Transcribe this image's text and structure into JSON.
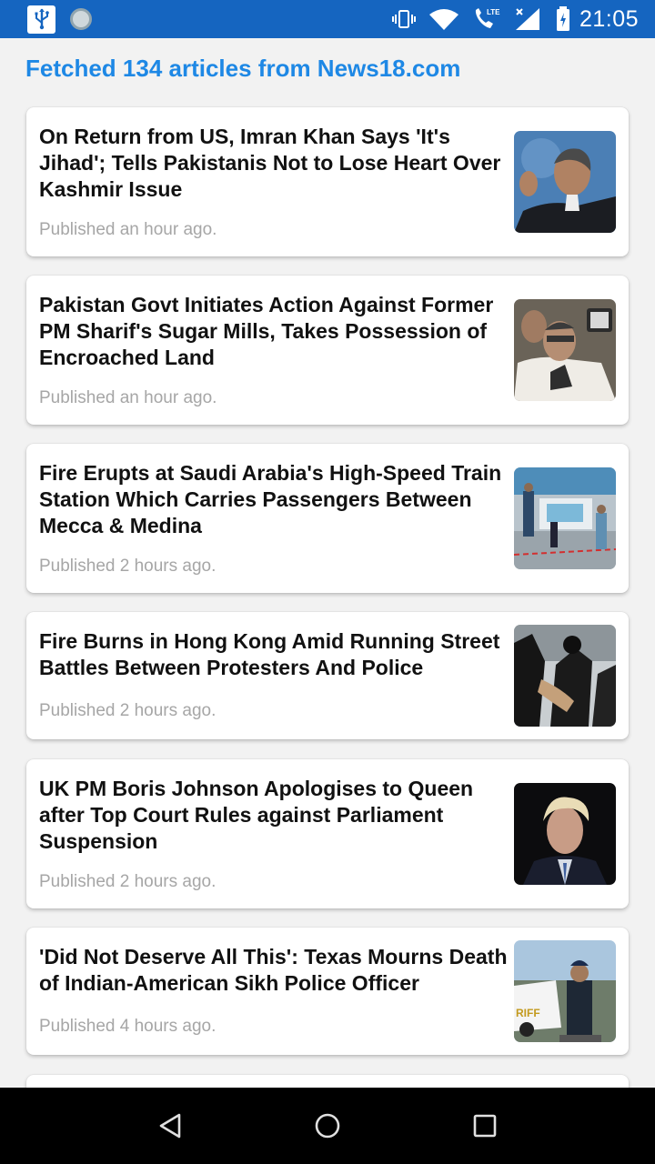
{
  "status_bar": {
    "time": "21:05",
    "icons": [
      "usb-icon",
      "sync-icon",
      "vibrate-icon",
      "wifi-icon",
      "lte-call-icon",
      "signal-icon",
      "battery-charging-icon"
    ],
    "lte_label": "LTE"
  },
  "header": {
    "text": "Fetched 134 articles from News18.com"
  },
  "articles": [
    {
      "title": "On Return from US, Imran Khan Says 'It's Jihad'; Tells Pakistanis Not to Lose Heart Over Kashmir Issue",
      "meta": "Published an hour ago.",
      "thumb": "imran-khan-photo"
    },
    {
      "title": "Pakistan Govt Initiates Action Against Former PM Sharif's Sugar Mills, Takes Possession of Encroached Land",
      "meta": "Published an hour ago.",
      "thumb": "nawaz-sharif-photo"
    },
    {
      "title": "Fire Erupts at Saudi Arabia's High-Speed Train Station Which Carries Passengers Between Mecca & Medina",
      "meta": "Published 2 hours ago.",
      "thumb": "train-station-photo"
    },
    {
      "title": "Fire Burns in Hong Kong Amid Running Street Battles Between Protesters And Police",
      "meta": "Published 2 hours ago.",
      "thumb": "hong-kong-protest-photo"
    },
    {
      "title": "UK PM Boris Johnson Apologises to Queen after Top Court Rules against Parliament Suspension",
      "meta": "Published 2 hours ago.",
      "thumb": "boris-johnson-photo"
    },
    {
      "title": "'Did Not Deserve All This': Texas Mourns Death of Indian-American Sikh Police Officer",
      "meta": "Published 4 hours ago.",
      "thumb": "sikh-officer-photo"
    }
  ],
  "nav_bar": {
    "buttons": [
      "back-button",
      "home-button",
      "recents-button"
    ]
  },
  "colors": {
    "status_bar": "#1565c0",
    "header_text": "#1e88e5",
    "meta_text": "#a6a6a6",
    "background": "#f2f2f2"
  }
}
